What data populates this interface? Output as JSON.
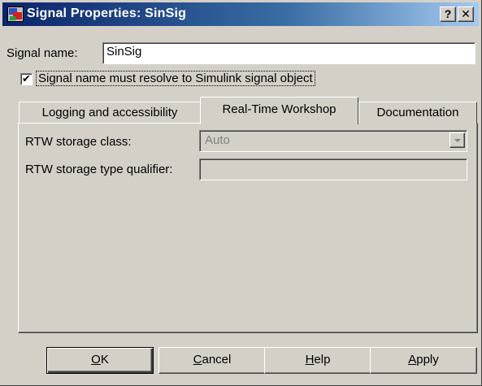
{
  "window": {
    "title": "Signal Properties: SinSig",
    "help_glyph": "?",
    "close_glyph": "✕"
  },
  "signal": {
    "name_label": "Signal name:",
    "name_value": "SinSig",
    "resolve_checked": true,
    "check_glyph": "✔",
    "resolve_label": "Signal name must resolve to Simulink signal object"
  },
  "tabs": [
    {
      "label": "Logging and accessibility",
      "active": false
    },
    {
      "label": "Real-Time Workshop",
      "active": true
    },
    {
      "label": "Documentation",
      "active": false
    }
  ],
  "rtw": {
    "storage_class_label": "RTW storage class:",
    "storage_class_value": "Auto",
    "type_qualifier_label": "RTW storage type qualifier:",
    "type_qualifier_value": ""
  },
  "buttons": {
    "ok_mnemonic": "O",
    "ok_rest": "K",
    "cancel_mnemonic": "C",
    "cancel_rest": "ancel",
    "help_mnemonic": "H",
    "help_rest": "elp",
    "apply_mnemonic": "A",
    "apply_rest": "pply"
  },
  "colors": {
    "title_bar_start": "#0a246a",
    "title_bar_end": "#a6caf0",
    "dialog_face": "#d4d0c8",
    "disabled_text": "#808080"
  }
}
